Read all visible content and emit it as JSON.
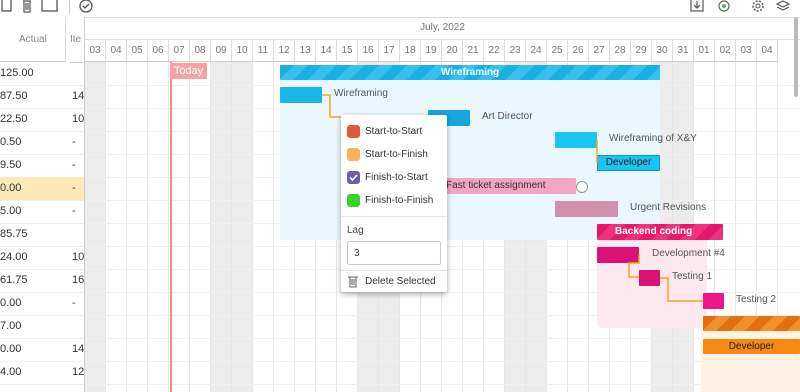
{
  "toolbar": {
    "left_icons": [
      "file-icon",
      "trash-icon",
      "square-icon",
      "check-circle-icon"
    ],
    "right_icons": [
      "download-icon",
      "settings-alt-icon",
      "gear-icon",
      "layers-icon"
    ]
  },
  "grid": {
    "columns": [
      "Actual",
      "Ite"
    ],
    "rows": [
      {
        "actual": "125.00",
        "items": ""
      },
      {
        "actual": "87.50",
        "items": "14"
      },
      {
        "actual": "22.50",
        "items": "10"
      },
      {
        "actual": "0.50",
        "items": "-"
      },
      {
        "actual": "9.50",
        "items": "-"
      },
      {
        "actual": "0.00",
        "items": "-",
        "highlight": true
      },
      {
        "actual": "5.00",
        "items": "-"
      },
      {
        "actual": "85.75",
        "items": ""
      },
      {
        "actual": "24.00",
        "items": "10"
      },
      {
        "actual": "61.75",
        "items": "16"
      },
      {
        "actual": "0.00",
        "items": "-"
      },
      {
        "actual": "7.00",
        "items": ""
      },
      {
        "actual": "0.00",
        "items": "14"
      },
      {
        "actual": "4.00",
        "items": "12"
      }
    ]
  },
  "timeline": {
    "month": "July, 2022",
    "days": [
      "03",
      "04",
      "05",
      "06",
      "07",
      "08",
      "09",
      "10",
      "11",
      "12",
      "13",
      "14",
      "15",
      "16",
      "17",
      "18",
      "19",
      "20",
      "21",
      "22",
      "23",
      "24",
      "25",
      "26",
      "27",
      "28",
      "29",
      "30",
      "31",
      "01",
      "02",
      "03",
      "04"
    ],
    "weekend_days": [
      "03",
      "09",
      "10",
      "16",
      "17",
      "23",
      "24",
      "30",
      "31"
    ],
    "today_label": "Today"
  },
  "tasks": [
    {
      "label": "Wireframing",
      "color": "#1cb5e8"
    },
    {
      "label": "Wireframing",
      "color": "#1cb5e8"
    },
    {
      "label": "Art Director",
      "color": "#16a6dc"
    },
    {
      "label": "Wireframing of X&Y",
      "color": "#1cc5f0"
    },
    {
      "label": "Developer",
      "color": "#1cc5f0"
    },
    {
      "label": "Fast ticket assignment",
      "color": "#f3a6c1"
    },
    {
      "label": "Urgent Revisions",
      "color": "#d08fab"
    },
    {
      "label": "Backend coding",
      "color": "#e5196c"
    },
    {
      "label": "Development #4",
      "color": "#d91273"
    },
    {
      "label": "Testing 1",
      "color": "#d91273"
    },
    {
      "label": "Testing 2",
      "color": "#f0148a"
    },
    {
      "label": "",
      "color": "#ee7d14"
    },
    {
      "label": "Developer",
      "color": "#f58a13"
    }
  ],
  "popup": {
    "options": [
      {
        "label": "Start-to-Start",
        "color": "#e05a3f",
        "checked": false
      },
      {
        "label": "Start-to-Finish",
        "color": "#f7b25b",
        "checked": false
      },
      {
        "label": "Finish-to-Start",
        "color": "#6d5fa8",
        "checked": true
      },
      {
        "label": "Finish-to-Finish",
        "color": "#3dd12d",
        "checked": false
      }
    ],
    "lag_label": "Lag",
    "lag_value": "3",
    "delete_label": "Delete Selected"
  }
}
